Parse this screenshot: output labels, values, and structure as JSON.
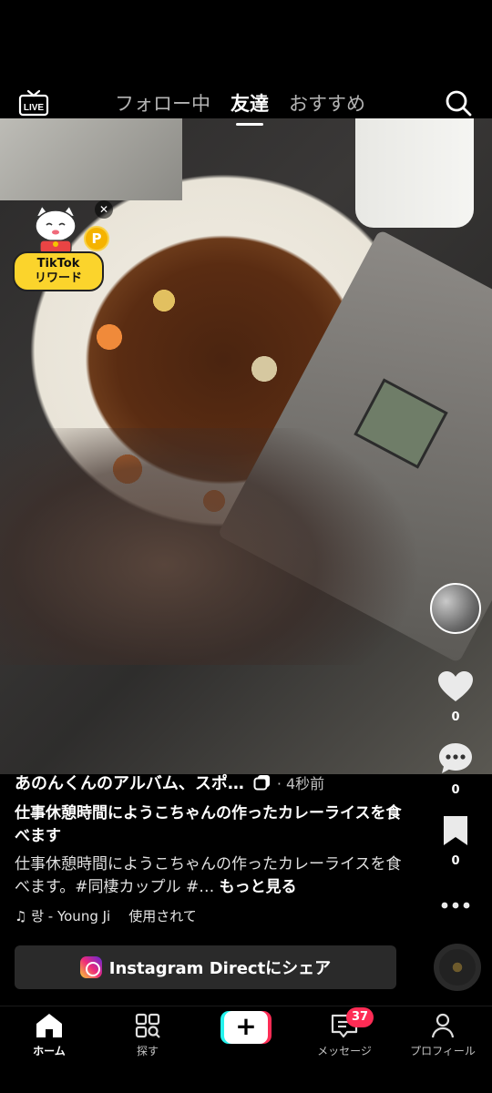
{
  "header": {
    "live_label": "LIVE",
    "tabs": [
      {
        "label": "フォロー中",
        "active": false
      },
      {
        "label": "友達",
        "active": true
      },
      {
        "label": "おすすめ",
        "active": false
      }
    ]
  },
  "reward": {
    "label_line1": "TikTok",
    "label_line2": "リワード",
    "coin": "P"
  },
  "rail": {
    "like_count": "0",
    "comment_count": "0",
    "bookmark_count": "0"
  },
  "post": {
    "author": "あのんくんのアルバム、スポ…",
    "time": "· 4秒前",
    "title": "仕事休憩時間にようこちゃんの作ったカレーライスを食べます",
    "description": "仕事休憩時間にようこちゃんの作ったカレーライスを食べます。#同棲カップル #…",
    "more_label": "もっと見る",
    "music": "♫ 랑 - Young Ji",
    "music_used": "使用されて"
  },
  "share": {
    "label": "Instagram Directにシェア"
  },
  "nav": {
    "home": "ホーム",
    "explore": "探す",
    "create": "+",
    "inbox": "メッセージ",
    "inbox_badge": "37",
    "profile": "プロフィール"
  },
  "colors": {
    "accent_red": "#fe2c55",
    "accent_cyan": "#25f4ee",
    "reward_yellow": "#fbd42c"
  }
}
